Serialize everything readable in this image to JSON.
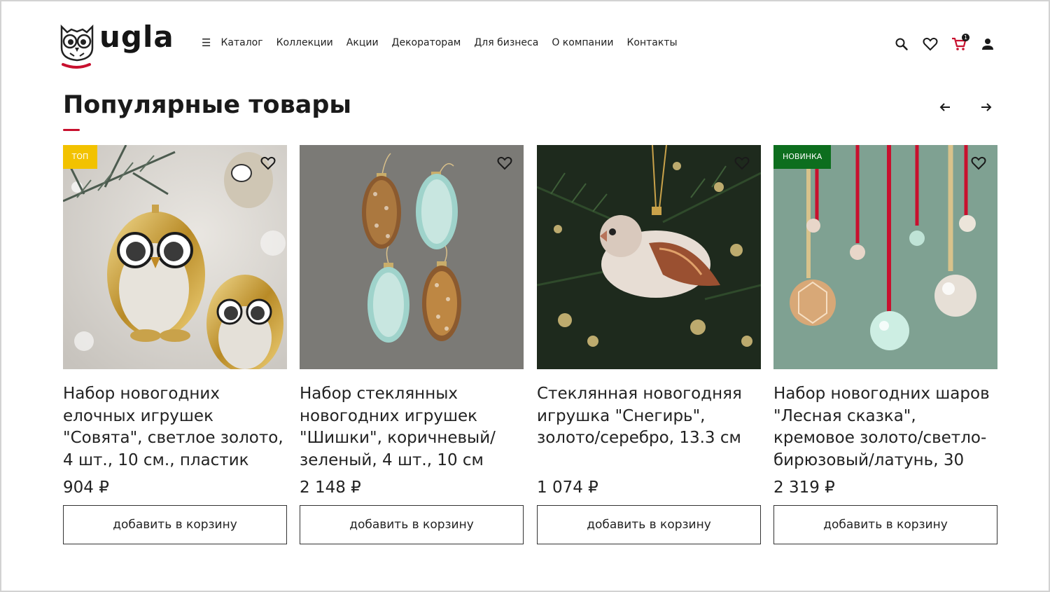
{
  "brand": {
    "name": "ugla"
  },
  "nav": {
    "menu_icon": "menu-icon",
    "items": [
      "Каталог",
      "Коллекции",
      "Акции",
      "Декораторам",
      "Для бизнеса",
      "О компании",
      "Контакты"
    ]
  },
  "header_icons": {
    "search": "search-icon",
    "favorites": "heart-icon",
    "cart": "cart-icon",
    "cart_count": "1",
    "account": "user-icon"
  },
  "section": {
    "title": "Популярные товары",
    "prev": "arrow-left-icon",
    "next": "arrow-right-icon"
  },
  "colors": {
    "accent": "#c8102e",
    "badge_top": "#f2c200",
    "badge_new": "#0d6e1e"
  },
  "products": [
    {
      "badge": "топ",
      "name": "Набор новогодних елочных игрушек \"Совята\", светлое золото, 4 шт., 10 см., пластик",
      "price": "904 ₽",
      "button": "добавить в корзину"
    },
    {
      "badge": "",
      "name": "Набор стеклянных новогодних игрушек \"Шишки\", коричневый/зеленый, 4 шт., 10 см",
      "price": "2 148 ₽",
      "button": "добавить в корзину"
    },
    {
      "badge": "",
      "name": "Стеклянная новогодняя игрушка \"Снегирь\", золото/серебро, 13.3 см",
      "price": "1 074 ₽",
      "button": "добавить в корзину"
    },
    {
      "badge": "Новинка",
      "name": "Набор новогодних шаров \"Лесная сказка\", кремовое золото/светло-бирюзовый/латунь, 30",
      "price": "2 319 ₽",
      "button": "добавить в корзину"
    }
  ]
}
